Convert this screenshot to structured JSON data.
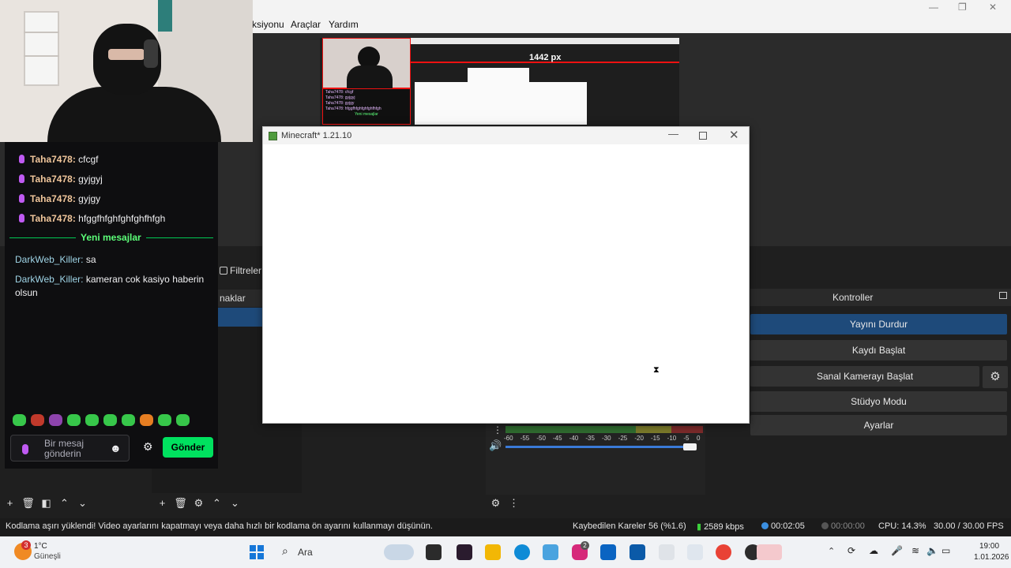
{
  "obs": {
    "menu": {
      "partial_item": "ksiyonu",
      "tools": "Araçlar",
      "help": "Yardım"
    },
    "window_controls": {
      "minimize": "—",
      "maximize": "❐",
      "close": "✕"
    },
    "preview": {
      "measure_label": "1442 px",
      "thumb_chat_lines": [
        "Taha7478: cfcgf",
        "Taha7478: gyjgyj",
        "Taha7478: gyjgy",
        "Taha7478: hfggfhfghfghfghfhfgh",
        "Yeni mesajlar"
      ]
    },
    "filters_label": "Filtreler",
    "sources_header": "naklar",
    "controls": {
      "title": "Kontroller",
      "stop_stream": "Yayını Durdur",
      "start_recording": "Kaydı Başlat",
      "start_virtual_cam": "Sanal Kamerayı Başlat",
      "studio_mode": "Stüdyo Modu",
      "settings": "Ayarlar"
    },
    "mixer": {
      "scale": [
        "-60",
        "-55",
        "-50",
        "-45",
        "-40",
        "-35",
        "-30",
        "-25",
        "-20",
        "-15",
        "-10",
        "-5",
        "0"
      ],
      "volume_fraction": 0.97
    },
    "status": {
      "warning": "Kodlama aşırı yüklendi! Video ayarlarını kapatmayı veya daha hızlı bir kodlama ön ayarını kullanmayı düşünün.",
      "dropped_frames": "Kaybedilen Kareler 56 (%1.6)",
      "bitrate": "2589 kbps",
      "stream_time": "00:02:05",
      "record_time": "00:00:00",
      "cpu": "CPU: 14.3%",
      "fps": "30.00 / 30.00 FPS"
    }
  },
  "chat": {
    "messages_top": [
      {
        "user": "Taha7478",
        "text": "cfcgf"
      },
      {
        "user": "Taha7478",
        "text": "gyjgyj"
      },
      {
        "user": "Taha7478",
        "text": "gyjgy"
      },
      {
        "user": "Taha7478",
        "text": "hfggfhfghfghfghfhfgh"
      }
    ],
    "new_messages_label": "Yeni mesajlar",
    "messages_new": [
      {
        "user": "DarkWeb_Killer",
        "text": "sa"
      },
      {
        "user": "DarkWeb_Killer",
        "text": "kameran cok kasiyo haberin",
        "text2": "olsun"
      }
    ],
    "input_placeholder": "Bir mesaj gönderin",
    "send_label": "Gönder"
  },
  "minecraft": {
    "title": "Minecraft* 1.21.10"
  },
  "taskbar": {
    "weather_temp": "1°C",
    "weather_desc": "Güneşli",
    "weather_badge": "3",
    "search_label": "Ara",
    "instagram_badge": "2",
    "time": "19:00",
    "date": "1.01.2026"
  },
  "colors": {
    "accent_blue": "#1e4a7a",
    "send_green": "#00e15f",
    "twitch_username": "#f0c69b",
    "new_messages_green": "#5cff79",
    "selection_red": "#ee1111"
  }
}
